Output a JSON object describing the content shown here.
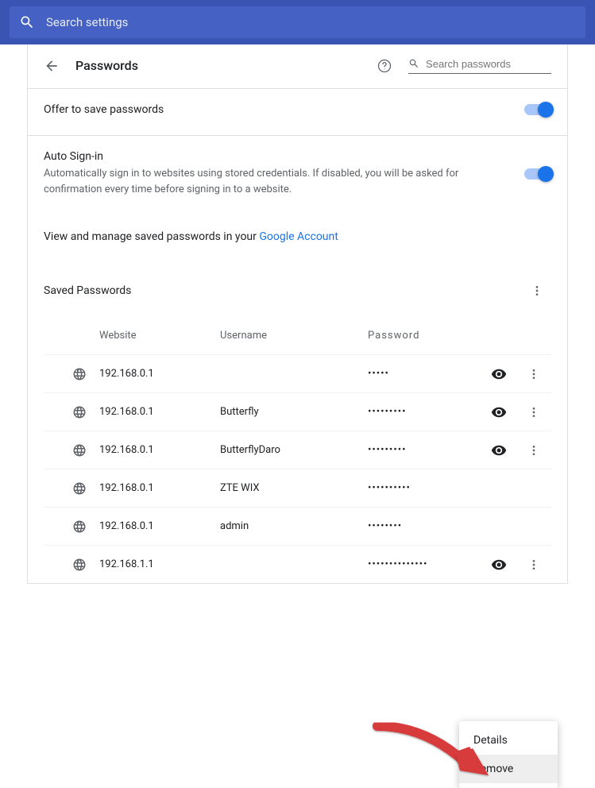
{
  "search_bar": {
    "placeholder": "Search settings"
  },
  "header": {
    "title": "Passwords",
    "search_placeholder": "Search passwords"
  },
  "offer": {
    "label": "Offer to save passwords"
  },
  "autosignin": {
    "label": "Auto Sign-in",
    "desc": "Automatically sign in to websites using stored credentials. If disabled, you will be asked for confirmation every time before signing in to a website."
  },
  "manage": {
    "prefix": "View and manage saved passwords in your ",
    "link": "Google Account"
  },
  "saved": {
    "title": "Saved Passwords",
    "cols": {
      "website": "Website",
      "username": "Username",
      "password": "Password"
    },
    "rows": [
      {
        "site": "192.168.0.1",
        "user": "",
        "dots": "•••••"
      },
      {
        "site": "192.168.0.1",
        "user": "Butterfly",
        "dots": "•••••••••"
      },
      {
        "site": "192.168.0.1",
        "user": "ButterflyDaro",
        "dots": "•••••••••"
      },
      {
        "site": "192.168.0.1",
        "user": "ZTE WIX",
        "dots": "••••••••••"
      },
      {
        "site": "192.168.0.1",
        "user": "admin",
        "dots": "••••••••"
      },
      {
        "site": "192.168.1.1",
        "user": "",
        "dots": "••••••••••••••"
      }
    ]
  },
  "popup": {
    "details": "Details",
    "remove": "Remove"
  }
}
